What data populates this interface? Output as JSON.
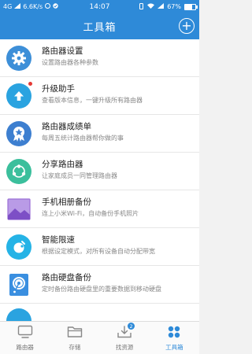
{
  "status_bar": {
    "network": "4G",
    "speed": "6.6K/s",
    "time": "14:07",
    "battery": "67%"
  },
  "header": {
    "title": "工具箱",
    "add_label": "+"
  },
  "tools": [
    {
      "name": "路由器设置",
      "desc": "设置路由器各种参数",
      "icon": "gear-icon",
      "color": "#3d8fd8"
    },
    {
      "name": "升级助手",
      "desc": "查看版本信息，一键升级所有路由器",
      "icon": "upgrade-arrow-icon",
      "color": "#2aa3e0",
      "badge": true
    },
    {
      "name": "路由器成绩单",
      "desc": "每周五统计路由器帮你做的事",
      "icon": "star-medal-icon",
      "color": "#3d7fd0"
    },
    {
      "name": "分享路由器",
      "desc": "让家庭成员一同管理路由器",
      "icon": "share-icon",
      "color": "#3bbf9c"
    },
    {
      "name": "手机相册备份",
      "desc": "连上小米Wi-Fi，自动备份手机照片",
      "icon": "photo-album-icon",
      "color": "#9b6fd6"
    },
    {
      "name": "智能限速",
      "desc": "根据设定模式，对所有设备自动分配带宽",
      "icon": "speed-limit-icon",
      "color": "#25b3e6"
    },
    {
      "name": "路由硬盘备份",
      "desc": "定时备份路由硬盘里的重要数据到移动硬盘",
      "icon": "disk-backup-icon",
      "color": "#3a8fe0"
    }
  ],
  "tabs": [
    {
      "label": "路由器",
      "icon": "monitor-icon",
      "active": false
    },
    {
      "label": "存储",
      "icon": "folder-icon",
      "active": false
    },
    {
      "label": "找资源",
      "icon": "download-icon",
      "active": false,
      "badge": "2"
    },
    {
      "label": "工具箱",
      "icon": "toolbox-grid-icon",
      "active": true,
      "dot": true
    }
  ],
  "colors": {
    "accent": "#2e8ad8",
    "badge_red": "#e53935"
  }
}
